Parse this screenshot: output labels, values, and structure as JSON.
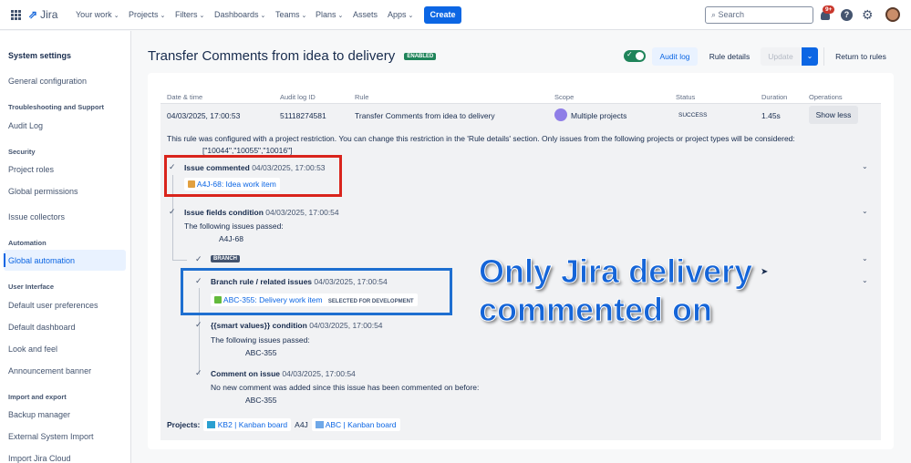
{
  "topbar": {
    "app_name": "Jira",
    "nav": [
      "Your work",
      "Projects",
      "Filters",
      "Dashboards",
      "Teams",
      "Plans",
      "Assets",
      "Apps"
    ],
    "nav_has_chevron": [
      true,
      true,
      true,
      true,
      true,
      true,
      false,
      true
    ],
    "create": "Create",
    "search_placeholder": "Search",
    "notif_badge": "9+"
  },
  "sidebar": {
    "title": "System settings",
    "items": [
      {
        "type": "item",
        "label": "General configuration"
      },
      {
        "type": "header",
        "label": "Troubleshooting and Support"
      },
      {
        "type": "item",
        "label": "Audit Log"
      },
      {
        "type": "header",
        "label": "Security"
      },
      {
        "type": "item",
        "label": "Project roles"
      },
      {
        "type": "item",
        "label": "Global permissions"
      },
      {
        "type": "item",
        "label": "Issue collectors"
      },
      {
        "type": "header",
        "label": "Automation"
      },
      {
        "type": "item",
        "label": "Global automation",
        "selected": true
      },
      {
        "type": "header",
        "label": "User Interface"
      },
      {
        "type": "item",
        "label": "Default user preferences"
      },
      {
        "type": "item",
        "label": "Default dashboard"
      },
      {
        "type": "item",
        "label": "Look and feel"
      },
      {
        "type": "item",
        "label": "Announcement banner"
      },
      {
        "type": "header",
        "label": "Import and export"
      },
      {
        "type": "item",
        "label": "Backup manager"
      },
      {
        "type": "item",
        "label": "External System Import"
      },
      {
        "type": "item",
        "label": "Import Jira Cloud"
      }
    ]
  },
  "header": {
    "title": "Transfer Comments from idea to delivery",
    "status": "ENABLED",
    "toggle_on": true,
    "audit_log": "Audit log",
    "rule_details": "Rule details",
    "update": "Update",
    "return": "Return to rules"
  },
  "table": {
    "headers": [
      "Date & time",
      "Audit log ID",
      "Rule",
      "Scope",
      "Status",
      "Duration",
      "Operations"
    ],
    "row": {
      "date": "04/03/2025, 17:00:53",
      "id": "51118274581",
      "rule": "Transfer Comments from idea to delivery",
      "scope": "Multiple projects",
      "status": "SUCCESS",
      "duration": "1.45s",
      "operation": "Show less"
    }
  },
  "details": {
    "restriction": "This rule was configured with a project restriction. You can change this restriction in the 'Rule details' section. Only issues from the following projects or project types will be considered:",
    "restriction_ids": "[\"10044\",\"10055\",\"10016\"]",
    "steps": [
      {
        "title": "Issue commented",
        "time": "04/03/2025, 17:00:53",
        "issue": "A4J-68: Idea work item"
      },
      {
        "title": "Issue fields condition",
        "time": "04/03/2025, 17:00:54",
        "text": "The following issues passed:",
        "value": "A4J-68"
      },
      {
        "branch": "BRANCH"
      },
      {
        "title": "Branch rule / related issues",
        "time": "04/03/2025, 17:00:54",
        "issue": "ABC-355: Delivery work item",
        "issue_status": "SELECTED FOR DEVELOPMENT"
      },
      {
        "title": "{{smart values}} condition",
        "time": "04/03/2025, 17:00:54",
        "text": "The following issues passed:",
        "value": "ABC-355"
      },
      {
        "title": "Comment on issue",
        "time": "04/03/2025, 17:00:54",
        "text": "No new comment was added since this issue has been commented on before:",
        "value": "ABC-355"
      }
    ],
    "projects_label": "Projects:",
    "projects": [
      "KB2 | Kanban board",
      "A4J",
      "ABC | Kanban board"
    ]
  },
  "annotation": {
    "line1": "Only Jira delivery",
    "line2": "commented on"
  }
}
